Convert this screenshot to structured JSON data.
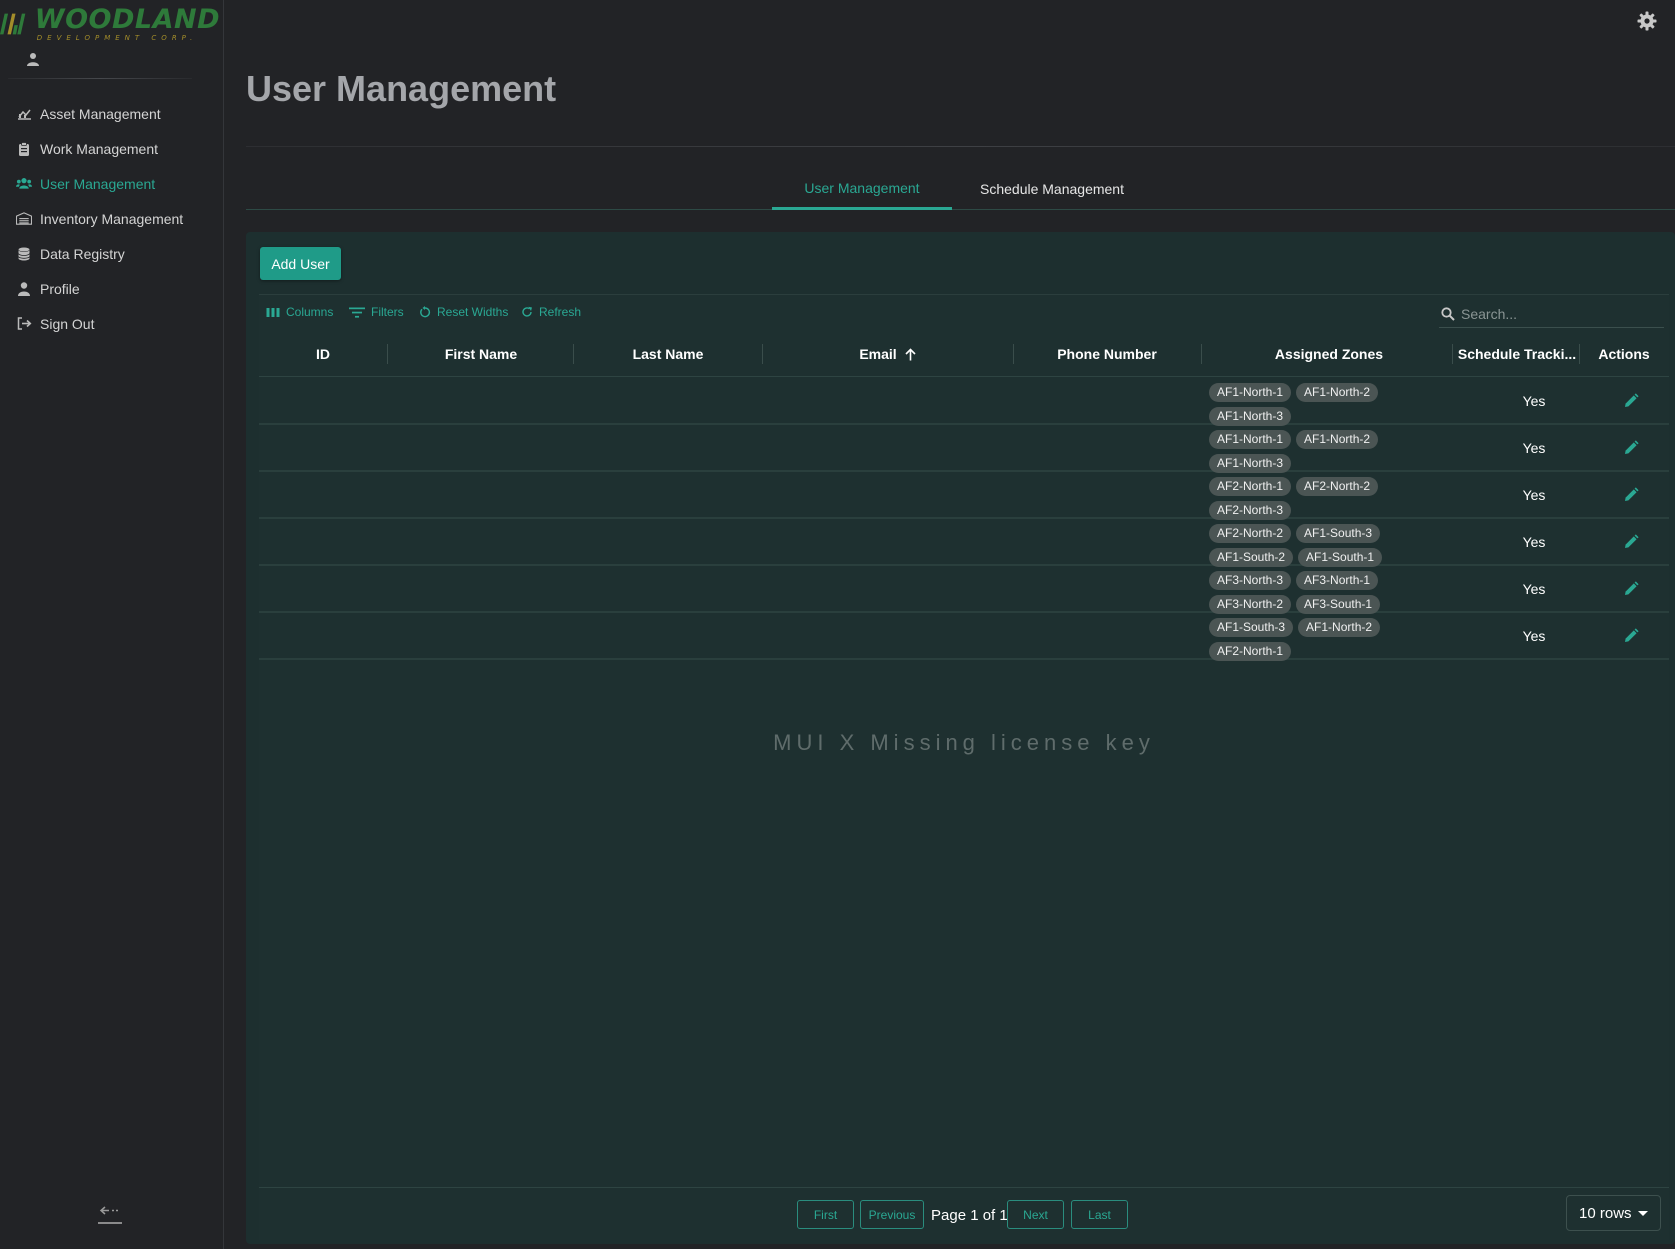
{
  "logo": {
    "word": "WOODLAND",
    "sub": "DEVELOPMENT CORP."
  },
  "sidebar": {
    "items": [
      {
        "label": "Asset Management",
        "icon": "chart-icon"
      },
      {
        "label": "Work Management",
        "icon": "clipboard-icon"
      },
      {
        "label": "User Management",
        "icon": "users-icon",
        "active": true
      },
      {
        "label": "Inventory Management",
        "icon": "warehouse-icon"
      },
      {
        "label": "Data Registry",
        "icon": "database-icon"
      },
      {
        "label": "Profile",
        "icon": "person-icon"
      },
      {
        "label": "Sign Out",
        "icon": "sign-out-icon"
      }
    ]
  },
  "header": {
    "title": "User Management"
  },
  "tabs": [
    {
      "label": "User Management",
      "active": true
    },
    {
      "label": "Schedule Management",
      "active": false
    }
  ],
  "actions": {
    "add_user": "Add User"
  },
  "toolbar": {
    "columns": "Columns",
    "filters": "Filters",
    "reset_widths": "Reset Widths",
    "refresh": "Refresh",
    "search_placeholder": "Search..."
  },
  "columns": {
    "id": "ID",
    "first_name": "First Name",
    "last_name": "Last Name",
    "email": "Email",
    "phone": "Phone Number",
    "zones": "Assigned Zones",
    "schedule": "Schedule Tracki...",
    "actions": "Actions"
  },
  "rows": [
    {
      "zones": [
        "AF1-North-1",
        "AF1-North-2",
        "AF1-North-3"
      ],
      "schedule": "Yes"
    },
    {
      "zones": [
        "AF1-North-1",
        "AF1-North-2",
        "AF1-North-3"
      ],
      "schedule": "Yes"
    },
    {
      "zones": [
        "AF2-North-1",
        "AF2-North-2",
        "AF2-North-3"
      ],
      "schedule": "Yes"
    },
    {
      "zones": [
        "AF2-North-2",
        "AF1-South-3",
        "AF1-South-2",
        "AF1-South-1"
      ],
      "schedule": "Yes"
    },
    {
      "zones": [
        "AF3-North-3",
        "AF3-North-1",
        "AF3-North-2",
        "AF3-South-1"
      ],
      "schedule": "Yes"
    },
    {
      "zones": [
        "AF1-South-3",
        "AF1-North-2",
        "AF2-North-1"
      ],
      "schedule": "Yes"
    }
  ],
  "watermark": "MUI X Missing license key",
  "pagination": {
    "first": "First",
    "previous": "Previous",
    "page_label": "Page 1 of 1",
    "next": "Next",
    "last": "Last",
    "rows_per_page": "10 rows"
  },
  "colors": {
    "accent": "#2aa893",
    "panel": "#1d2f2f",
    "background": "#222326"
  }
}
